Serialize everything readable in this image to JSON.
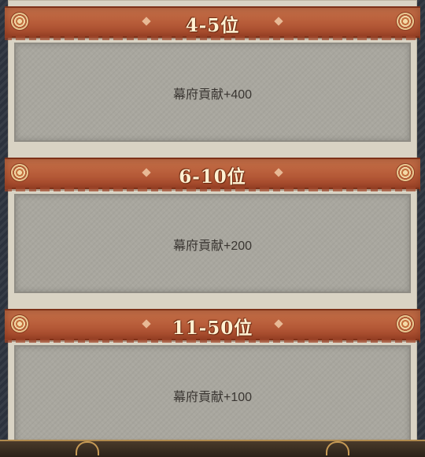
{
  "ranks": [
    {
      "title": "4-5位",
      "reward": "幕府貢献+400"
    },
    {
      "title": "6-10位",
      "reward": "幕府貢献+200"
    },
    {
      "title": "11-50位",
      "reward": "幕府貢献+100"
    }
  ],
  "colors": {
    "banner": "#b95f3b",
    "panel": "#a9a79f",
    "frame": "#d9d3c4",
    "background": "#2f3540"
  }
}
